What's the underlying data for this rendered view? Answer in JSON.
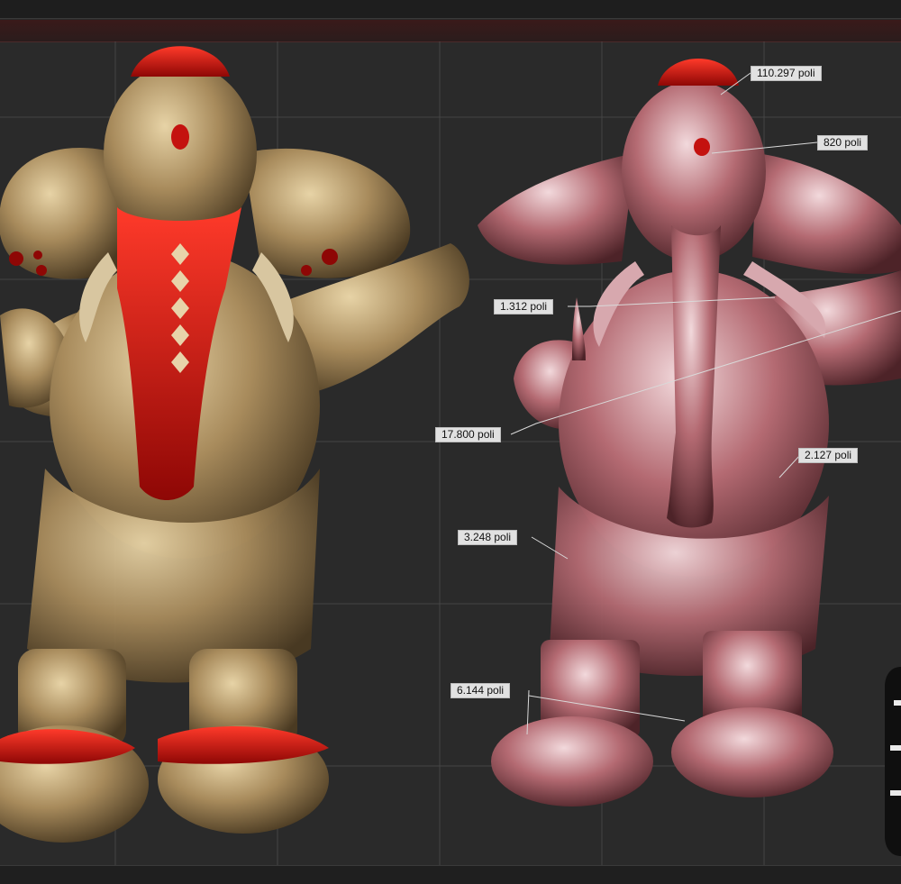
{
  "callouts": [
    {
      "id": "head",
      "label": "110.297 poli"
    },
    {
      "id": "bindi",
      "label": "820 poli"
    },
    {
      "id": "hand",
      "label": "1.312 poli"
    },
    {
      "id": "arm",
      "label": "17.800 poli"
    },
    {
      "id": "body",
      "label": "2.127 poli"
    },
    {
      "id": "cloth",
      "label": "3.248 poli"
    },
    {
      "id": "feet",
      "label": "6.144 poli"
    }
  ],
  "colors": {
    "background": "#2a2a2a",
    "grid": "#5a5a5a",
    "gold_body": "#a88b5c",
    "red_accent": "#c4120f",
    "pink_body": "#b46a72",
    "label_bg": "#e1e1e1"
  },
  "icons": [
    "grid-overlay",
    "sculpted-elephant-model",
    "lowpoly-elephant-model",
    "side-tool-icon"
  ]
}
